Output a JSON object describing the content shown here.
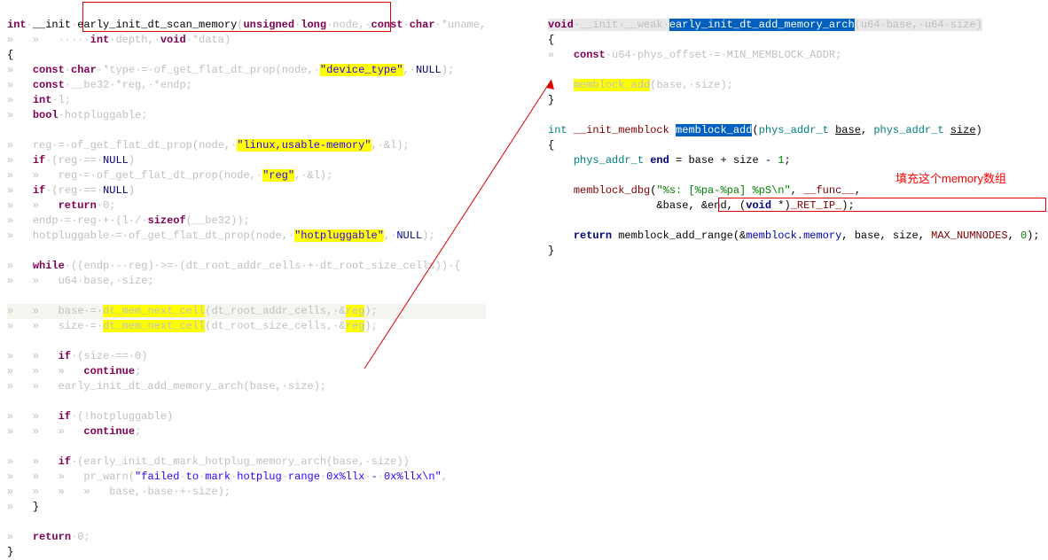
{
  "left_code": {
    "l1a": "int",
    "l1b": "__init",
    "l1c": "early_init_dt_scan_memory",
    "l1d": "unsigned",
    "l1e": "long",
    "l1f": "node",
    "l1g": "const",
    "l1h": "char",
    "l1i": "uname",
    "l2a": "int",
    "l2b": "depth",
    "l2c": "void",
    "l2d": "data",
    "l3": "{",
    "l4a": "const",
    "l4b": "char",
    "l4c": "type",
    "l4d": "of_get_flat_dt_prop",
    "l4e": "node",
    "l4f": "\"device_type\"",
    "l4g": "NULL",
    "l5a": "const",
    "l5b": "__be32",
    "l5c": "reg",
    "l5d": "endp",
    "l6a": "int",
    "l6b": "l",
    "l7a": "bool",
    "l7b": "hotpluggable",
    "l8a": "reg",
    "l8b": "of_get_flat_dt_prop",
    "l8c": "node",
    "l8d": "\"linux,usable-memory\"",
    "l8e": "l",
    "l9a": "if",
    "l9b": "reg",
    "l9c": "NULL",
    "l10a": "reg",
    "l10b": "of_get_flat_dt_prop",
    "l10c": "node",
    "l10d": "\"reg\"",
    "l10e": "l",
    "l11a": "if",
    "l11b": "reg",
    "l11c": "NULL",
    "l12a": "return",
    "l12b": "0",
    "l13a": "endp",
    "l13b": "reg",
    "l13c": "l",
    "l13d": "sizeof",
    "l13e": "__be32",
    "l14a": "hotpluggable",
    "l14b": "of_get_flat_dt_prop",
    "l14c": "node",
    "l14d": "\"hotpluggable\"",
    "l14e": "NULL",
    "l15a": "while",
    "l15b": "endp",
    "l15c": "reg",
    "l15d": "dt_root_addr_cells",
    "l15e": "dt_root_size_cells",
    "l16a": "u64",
    "l16b": "base",
    "l16c": "size",
    "l17a": "base",
    "l17b": "dt_mem_n",
    "l17c": "ext_cell",
    "l17d": "dt_root_addr_cells",
    "l17e": "reg",
    "l18a": "size",
    "l18b": "dt_mem_next_cell",
    "l18c": "dt_root_size_cells",
    "l18d": "reg",
    "l19a": "if",
    "l19b": "size",
    "l19c": "0",
    "l20a": "continue",
    "l21a": "early_init_dt_add_memory_arch",
    "l21b": "base",
    "l21c": "size",
    "l22a": "if",
    "l22b": "hotpluggable",
    "l23a": "continue",
    "l24a": "if",
    "l24b": "early_init_dt_mark_hotplug_memory_arch",
    "l24c": "base",
    "l24d": "size",
    "l25a": "pr_warn",
    "l25b": "\"failed",
    "l25c": "to",
    "l25d": "mark",
    "l25e": "hotplug",
    "l25f": "range",
    "l25g": "0x%llx",
    "l25h": "-",
    "l25i": "0x%llx\\n\"",
    "l26a": "base",
    "l26b": "base",
    "l26c": "size",
    "l27": "}",
    "l28a": "return",
    "l28b": "0",
    "l29": "}"
  },
  "right_code": {
    "r1a": "void",
    "r1b": "__init",
    "r1c": "__weak",
    "r1d": "early_init_dt_add_memory_arch",
    "r1e": "u64",
    "r1f": "base",
    "r1g": "u64",
    "r1h": "size",
    "r2": "{",
    "r3a": "const",
    "r3b": "u64",
    "r3c": "phys_offset",
    "r3d": "MIN_MEMBLOCK_ADDR",
    "r4a": "memblock_add",
    "r4b": "base",
    "r4c": "size",
    "r5": "}",
    "r6a": "int",
    "r6b": "__init_memblock",
    "r6c": "memblock_add",
    "r6d": "phys_addr_t",
    "r6e": "base",
    "r6f": "phys_addr_t",
    "r6g": "size",
    "r7": "{",
    "r8a": "phys_addr_t",
    "r8b": "end",
    "r8c": "base",
    "r8d": "size",
    "r8e": "1",
    "r9a": "memblock_dbg",
    "r9b": "\"%s: [%pa-%pa] %pS\\n\"",
    "r9c": "__func__",
    "r10a": "base",
    "r10b": "end",
    "r10c": "void",
    "r10d": "_RET_IP_",
    "r11a": "return",
    "r11b": "memblock_add_range",
    "r11c": "memblock",
    "r11d": "memory",
    "r11e": "base",
    "r11f": "size",
    "r11g": "MAX_NUMNODES",
    "r11h": "0",
    "r12": "}"
  },
  "annotation": "填充这个memory数组"
}
